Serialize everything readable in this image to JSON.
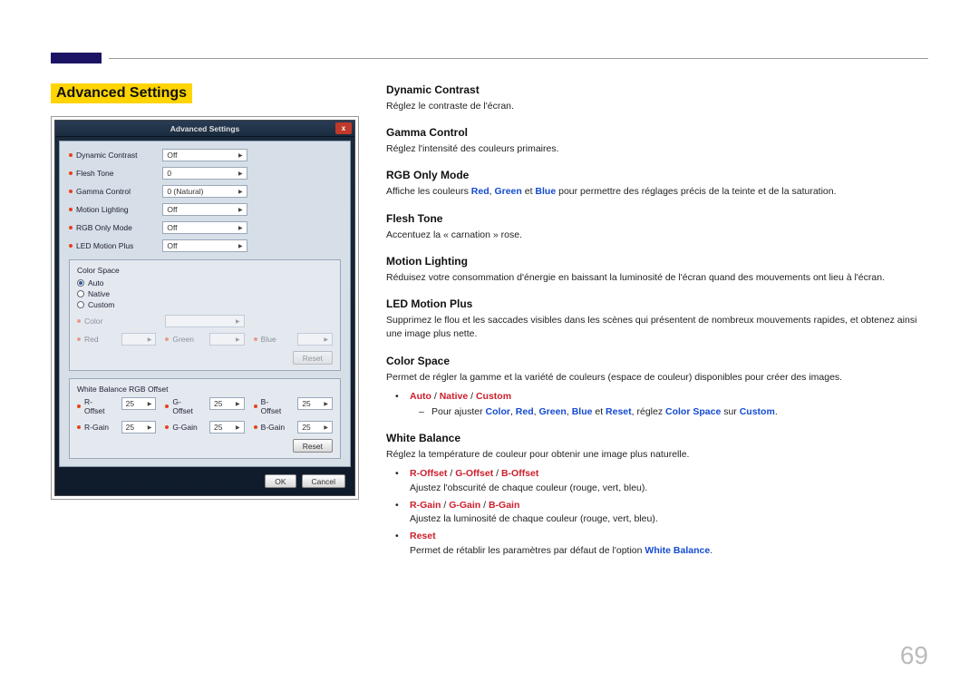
{
  "page_number": "69",
  "section_title": "Advanced Settings",
  "dialog": {
    "title": "Advanced Settings",
    "close": "x",
    "fields": {
      "dynamic_contrast": {
        "label": "Dynamic Contrast",
        "value": "Off"
      },
      "flesh_tone": {
        "label": "Flesh Tone",
        "value": "0"
      },
      "gamma_control": {
        "label": "Gamma Control",
        "value": "0 (Natural)"
      },
      "motion_lighting": {
        "label": "Motion Lighting",
        "value": "Off"
      },
      "rgb_only": {
        "label": "RGB Only Mode",
        "value": "Off"
      },
      "led_motion_plus": {
        "label": "LED Motion Plus",
        "value": "Off"
      }
    },
    "color_space": {
      "title": "Color Space",
      "options": [
        "Auto",
        "Native",
        "Custom"
      ],
      "sliders": {
        "color": {
          "label": "Color",
          "value": ""
        },
        "red": {
          "label": "Red",
          "value": ""
        },
        "green": {
          "label": "Green",
          "value": ""
        },
        "blue": {
          "label": "Blue",
          "value": ""
        }
      },
      "reset": "Reset"
    },
    "white_balance": {
      "title": "White Balance RGB Offset",
      "r_offset": {
        "label": "R-Offset",
        "value": "25"
      },
      "g_offset": {
        "label": "G-Offset",
        "value": "25"
      },
      "b_offset": {
        "label": "B-Offset",
        "value": "25"
      },
      "r_gain": {
        "label": "R-Gain",
        "value": "25"
      },
      "g_gain": {
        "label": "G-Gain",
        "value": "25"
      },
      "b_gain": {
        "label": "B-Gain",
        "value": "25"
      },
      "reset": "Reset"
    },
    "buttons": {
      "ok": "OK",
      "cancel": "Cancel"
    }
  },
  "body": {
    "dynamic_contrast": {
      "title": "Dynamic Contrast",
      "desc": "Réglez le contraste de l'écran."
    },
    "gamma_control": {
      "title": "Gamma Control",
      "desc": "Réglez l'intensité des couleurs primaires."
    },
    "rgb_only": {
      "title": "RGB Only Mode",
      "pre": "Affiche les couleurs ",
      "r": "Red",
      "g": "Green",
      "b": "Blue",
      "sep1": ", ",
      "sep2": " et ",
      "post": " pour permettre des réglages précis de la teinte et de la saturation."
    },
    "flesh_tone": {
      "title": "Flesh Tone",
      "desc": "Accentuez la « carnation » rose."
    },
    "motion_lighting": {
      "title": "Motion Lighting",
      "desc": "Réduisez votre consommation d'énergie en baissant la luminosité de l'écran quand des mouvements ont lieu à l'écran."
    },
    "led_motion_plus": {
      "title": "LED Motion Plus",
      "desc": "Supprimez le flou et les saccades visibles dans les scènes qui présentent de nombreux mouvements rapides, et obtenez ainsi une image plus nette."
    },
    "color_space": {
      "title": "Color Space",
      "desc": "Permet de régler la gamme et la variété de couleurs (espace de couleur) disponibles pour créer des images.",
      "opt1": "Auto",
      "opt2": "Native",
      "opt3": "Custom",
      "slash": " / ",
      "sub_pre": "Pour ajuster ",
      "c": "Color",
      "r": "Red",
      "g": "Green",
      "b": "Blue",
      "reset": "Reset",
      "sub_mid1": ", réglez ",
      "cs": "Color Space",
      "sub_mid2": " sur ",
      "cu": "Custom",
      "sub_end": ".",
      "comma": ", ",
      "et": " et "
    },
    "white_balance": {
      "title": "White Balance",
      "desc": "Réglez la température de couleur pour obtenir une image plus naturelle.",
      "offset_r": "R-Offset",
      "offset_g": "G-Offset",
      "offset_b": "B-Offset",
      "offset_desc": "Ajustez l'obscurité de chaque couleur (rouge, vert, bleu).",
      "gain_r": "R-Gain",
      "gain_g": "G-Gain",
      "gain_b": "B-Gain",
      "gain_desc": "Ajustez la luminosité de chaque couleur (rouge, vert, bleu).",
      "reset": "Reset",
      "reset_pre": "Permet de rétablir les paramètres par défaut de l'option ",
      "wb": "White Balance",
      "dot": ".",
      "slash": " / "
    }
  }
}
